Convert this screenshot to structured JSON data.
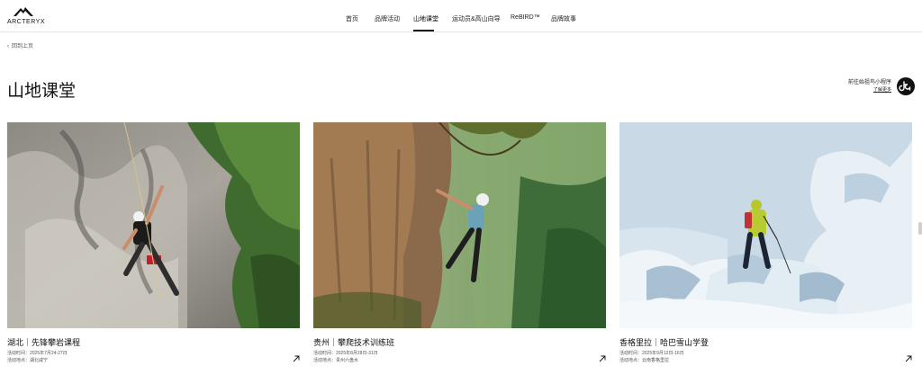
{
  "brand": {
    "name": "ARCTERYX"
  },
  "nav": {
    "items": [
      {
        "label": "首页"
      },
      {
        "label": "品牌活动"
      },
      {
        "label": "山地课堂"
      },
      {
        "label": "运动员&高山向导"
      },
      {
        "label": "ReBIRD™"
      },
      {
        "label": "品牌故事"
      }
    ],
    "active_index": 2
  },
  "back": {
    "label": "回到上页"
  },
  "page": {
    "title": "山地课堂"
  },
  "mini_program": {
    "line1": "前往始祖鸟小程序",
    "line2": "了解更多",
    "icon": "mini-program-icon"
  },
  "cards": [
    {
      "title": "湖北｜先锋攀岩课程",
      "date": "活动时间：2025年7月24-27日",
      "location": "活动地点：湖北咸宁",
      "arrow_icon": "arrow-up-right-icon"
    },
    {
      "title": "贵州｜攀爬技术训练班",
      "date": "活动时间：2025年8月28日-31日",
      "location": "活动地点：贵州六盘水",
      "arrow_icon": "arrow-up-right-icon"
    },
    {
      "title": "香格里拉｜哈巴雪山学登",
      "date": "活动时间：2025年9月12日-16日",
      "location": "活动地点：云南香格里拉",
      "arrow_icon": "arrow-up-right-icon"
    }
  ],
  "colors": {
    "text": "#111111",
    "accent": "#111111",
    "divider": "#e6e6e6"
  }
}
